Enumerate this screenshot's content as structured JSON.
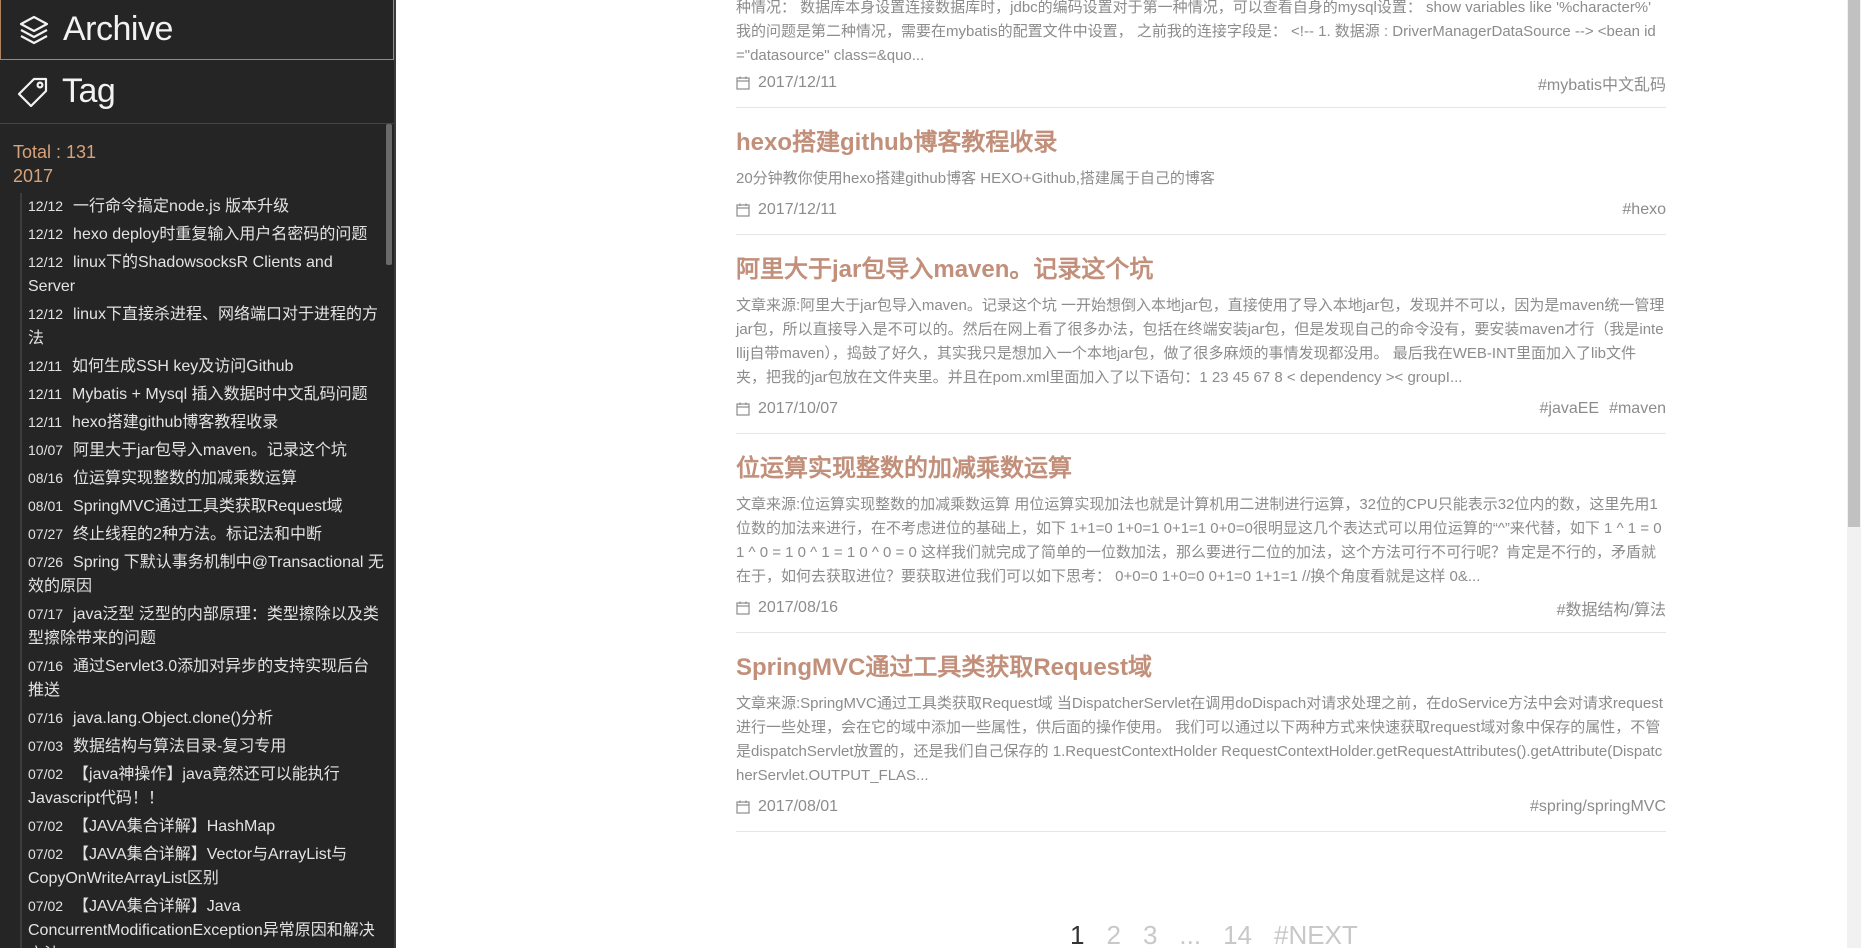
{
  "sidebar": {
    "archive_label": "Archive",
    "tag_label": "Tag",
    "total": "Total : 131",
    "year": "2017",
    "items": [
      {
        "date": "12/12",
        "title": "一行命令搞定node.js 版本升级"
      },
      {
        "date": "12/12",
        "title": "hexo deploy时重复输入用户名密码的问题"
      },
      {
        "date": "12/12",
        "title": "linux下的ShadowsocksR Clients and Server"
      },
      {
        "date": "12/12",
        "title": "linux下直接杀进程、网络端口对于进程的方法"
      },
      {
        "date": "12/11",
        "title": "如何生成SSH key及访问Github"
      },
      {
        "date": "12/11",
        "title": "Mybatis + Mysql 插入数据时中文乱码问题"
      },
      {
        "date": "12/11",
        "title": "hexo搭建github博客教程收录"
      },
      {
        "date": "10/07",
        "title": "阿里大于jar包导入maven。记录这个坑"
      },
      {
        "date": "08/16",
        "title": "位运算实现整数的加减乘数运算"
      },
      {
        "date": "08/01",
        "title": "SpringMVC通过工具类获取Request域"
      },
      {
        "date": "07/27",
        "title": "终止线程的2种方法。标记法和中断"
      },
      {
        "date": "07/26",
        "title": "Spring 下默认事务机制中@Transactional 无效的原因"
      },
      {
        "date": "07/17",
        "title": "java泛型 泛型的内部原理：类型擦除以及类型擦除带来的问题"
      },
      {
        "date": "07/16",
        "title": "通过Servlet3.0添加对异步的支持实现后台推送"
      },
      {
        "date": "07/16",
        "title": "java.lang.Object.clone()分析"
      },
      {
        "date": "07/03",
        "title": "数据结构与算法目录-复习专用"
      },
      {
        "date": "07/02",
        "title": "【java神操作】java竟然还可以能执行Javascript代码！！"
      },
      {
        "date": "07/02",
        "title": "【JAVA集合详解】HashMap"
      },
      {
        "date": "07/02",
        "title": "【JAVA集合详解】Vector与ArrayList与CopyOnWriteArrayList区别"
      },
      {
        "date": "07/02",
        "title": "【JAVA集合详解】Java ConcurrentModificationException异常原因和解决方法"
      }
    ]
  },
  "posts": [
    {
      "title": "",
      "excerpt": "种情况：  数据库本身设置连接数据库时，jdbc的编码设置对于第一种情况，可以查看自身的mysql设置：  show variables like '%character%' 我的问题是第二种情况，需要在mybatis的配置文件中设置，  之前我的连接字段是：  <!-- 1. 数据源 : DriverManagerDataSource --> <bean id=\"datasource\" class=&quo...",
      "date": "2017/12/11",
      "tags": [
        "#mybatis中文乱码"
      ]
    },
    {
      "title": "hexo搭建github博客教程收录",
      "excerpt": "20分钟教你使用hexo搭建github博客 HEXO+Github,搭建属于自己的博客",
      "date": "2017/12/11",
      "tags": [
        "#hexo"
      ]
    },
    {
      "title": "阿里大于jar包导入maven。记录这个坑",
      "excerpt": "文章来源:阿里大于jar包导入maven。记录这个坑 一开始想倒入本地jar包，直接使用了导入本地jar包，发现并不可以，因为是maven统一管理jar包，所以直接导入是不可以的。然后在网上看了很多办法，包括在终端安装jar包，但是发现自己的命令没有，要安装maven才行（我是intellij自带maven），捣鼓了好久，其实我只是想加入一个本地jar包，做了很多麻烦的事情发现都没用。 最后我在WEB-INT里面加入了lib文件夹，把我的jar包放在文件夹里。并且在pom.xml里面加入了以下语句：1 23 45 67 8 < dependency >< groupI...",
      "date": "2017/10/07",
      "tags": [
        "#javaEE",
        "#maven"
      ]
    },
    {
      "title": "位运算实现整数的加减乘数运算",
      "excerpt": "文章来源:位运算实现整数的加减乘数运算 用位运算实现加法也就是计算机用二进制进行运算，32位的CPU只能表示32位内的数，这里先用1位数的加法来进行，在不考虑进位的基础上，如下 1+1=0 1+0=1 0+1=1 0+0=0很明显这几个表达式可以用位运算的“^”来代替，如下 1 ^ 1 = 0 1 ^ 0 = 1 0 ^ 1 = 1 0 ^ 0 = 0 这样我们就完成了简单的一位数加法，那么要进行二位的加法，这个方法可行不可行呢？肯定是不行的，矛盾就在于，如何去获取进位？要获取进位我们可以如下思考： 0+0=0 1+0=0 0+1=0 1+1=1 //换个角度看就是这样 0&...",
      "date": "2017/08/16",
      "tags": [
        "#数据结构/算法"
      ]
    },
    {
      "title": "SpringMVC通过工具类获取Request域",
      "excerpt": "文章来源:SpringMVC通过工具类获取Request域 当DispatcherServlet在调用doDispach对请求处理之前，在doService方法中会对请求request进行一些处理，会在它的域中添加一些属性，供后面的操作使用。 我们可以通过以下两种方式来快速获取request域对象中保存的属性，不管是dispatchServlet放置的，还是我们自己保存的 1.RequestContextHolder RequestContextHolder.getRequestAttributes().getAttribute(DispatcherServlet.OUTPUT_FLAS...",
      "date": "2017/08/01",
      "tags": [
        "#spring/springMVC"
      ]
    }
  ],
  "pagination": {
    "current": "1",
    "pages": [
      "2",
      "3",
      "...",
      "14"
    ],
    "next": "#NEXT"
  }
}
